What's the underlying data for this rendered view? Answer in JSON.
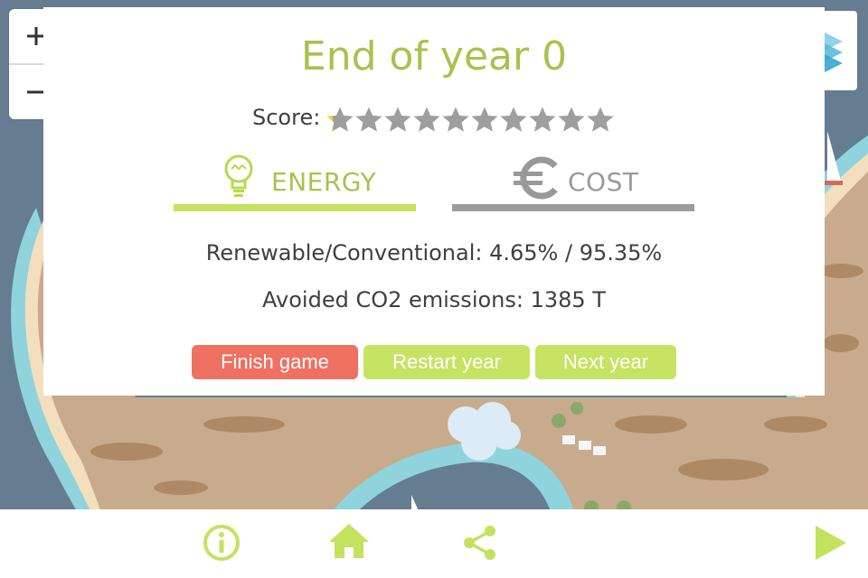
{
  "map": {
    "sea_color": "#667d91",
    "land_color": "#c7ab8c",
    "shore_color": "#f3dfbd",
    "shallow_water_color": "#8fd3dd"
  },
  "zoom": {
    "zoom_in_label": "+",
    "zoom_out_label": "−"
  },
  "layers_button": {
    "icon": "layers-icon"
  },
  "dialog": {
    "title": "End of year 0",
    "score_label": "Score:",
    "score": {
      "value": 0.25,
      "max": 10
    },
    "tabs": [
      {
        "label": "ENERGY",
        "icon": "lightbulb-icon",
        "active": true,
        "color": "#c4e25e"
      },
      {
        "label": "COST",
        "icon": "euro-icon",
        "active": false,
        "color": "#9c9c9c"
      }
    ],
    "stats": {
      "renewable_conventional": "Renewable/Conventional: 4.65% / 95.35%",
      "avoided_co2": "Avoided CO2 emissions: 1385 T"
    },
    "buttons": {
      "finish": "Finish game",
      "restart": "Restart year",
      "next": "Next year"
    },
    "colors": {
      "title": "#a9c24e",
      "finish_button": "#ef7162",
      "secondary_button": "#c6e363",
      "star_fill": "#f7d031",
      "star_empty": "#9e9e9e"
    }
  },
  "toolbar": {
    "icons": [
      "info-icon",
      "home-icon",
      "share-icon",
      "play-icon"
    ],
    "color": "#c4e25e"
  }
}
